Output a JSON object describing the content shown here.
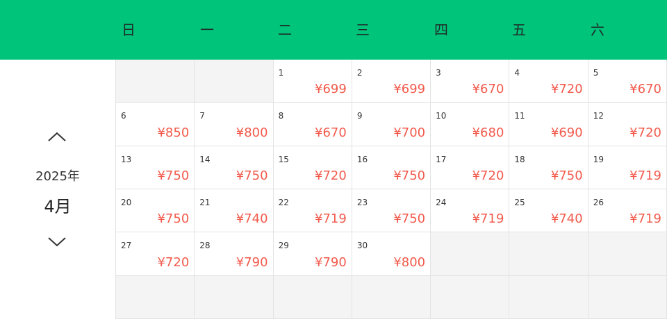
{
  "header": {
    "weekdays": [
      "日",
      "一",
      "二",
      "三",
      "四",
      "五",
      "六"
    ],
    "background_color": "#00c47a"
  },
  "nav": {
    "prev_icon": "chevron-up-icon",
    "next_icon": "chevron-down-icon",
    "year": "2025年",
    "month": "4月"
  },
  "calendar": {
    "price_color": "#f25a4c",
    "leading_empty": 2,
    "total_cells": 42,
    "days": [
      {
        "day": "1",
        "price": "¥699"
      },
      {
        "day": "2",
        "price": "¥699"
      },
      {
        "day": "3",
        "price": "¥670"
      },
      {
        "day": "4",
        "price": "¥720"
      },
      {
        "day": "5",
        "price": "¥670"
      },
      {
        "day": "6",
        "price": "¥850"
      },
      {
        "day": "7",
        "price": "¥800"
      },
      {
        "day": "8",
        "price": "¥670"
      },
      {
        "day": "9",
        "price": "¥700"
      },
      {
        "day": "10",
        "price": "¥680"
      },
      {
        "day": "11",
        "price": "¥690"
      },
      {
        "day": "12",
        "price": "¥720"
      },
      {
        "day": "13",
        "price": "¥750"
      },
      {
        "day": "14",
        "price": "¥750"
      },
      {
        "day": "15",
        "price": "¥720"
      },
      {
        "day": "16",
        "price": "¥750"
      },
      {
        "day": "17",
        "price": "¥720"
      },
      {
        "day": "18",
        "price": "¥750"
      },
      {
        "day": "19",
        "price": "¥719"
      },
      {
        "day": "20",
        "price": "¥750"
      },
      {
        "day": "21",
        "price": "¥740"
      },
      {
        "day": "22",
        "price": "¥719"
      },
      {
        "day": "23",
        "price": "¥750"
      },
      {
        "day": "24",
        "price": "¥719"
      },
      {
        "day": "25",
        "price": "¥740"
      },
      {
        "day": "26",
        "price": "¥719"
      },
      {
        "day": "27",
        "price": "¥720"
      },
      {
        "day": "28",
        "price": "¥790"
      },
      {
        "day": "29",
        "price": "¥790"
      },
      {
        "day": "30",
        "price": "¥800"
      }
    ]
  }
}
